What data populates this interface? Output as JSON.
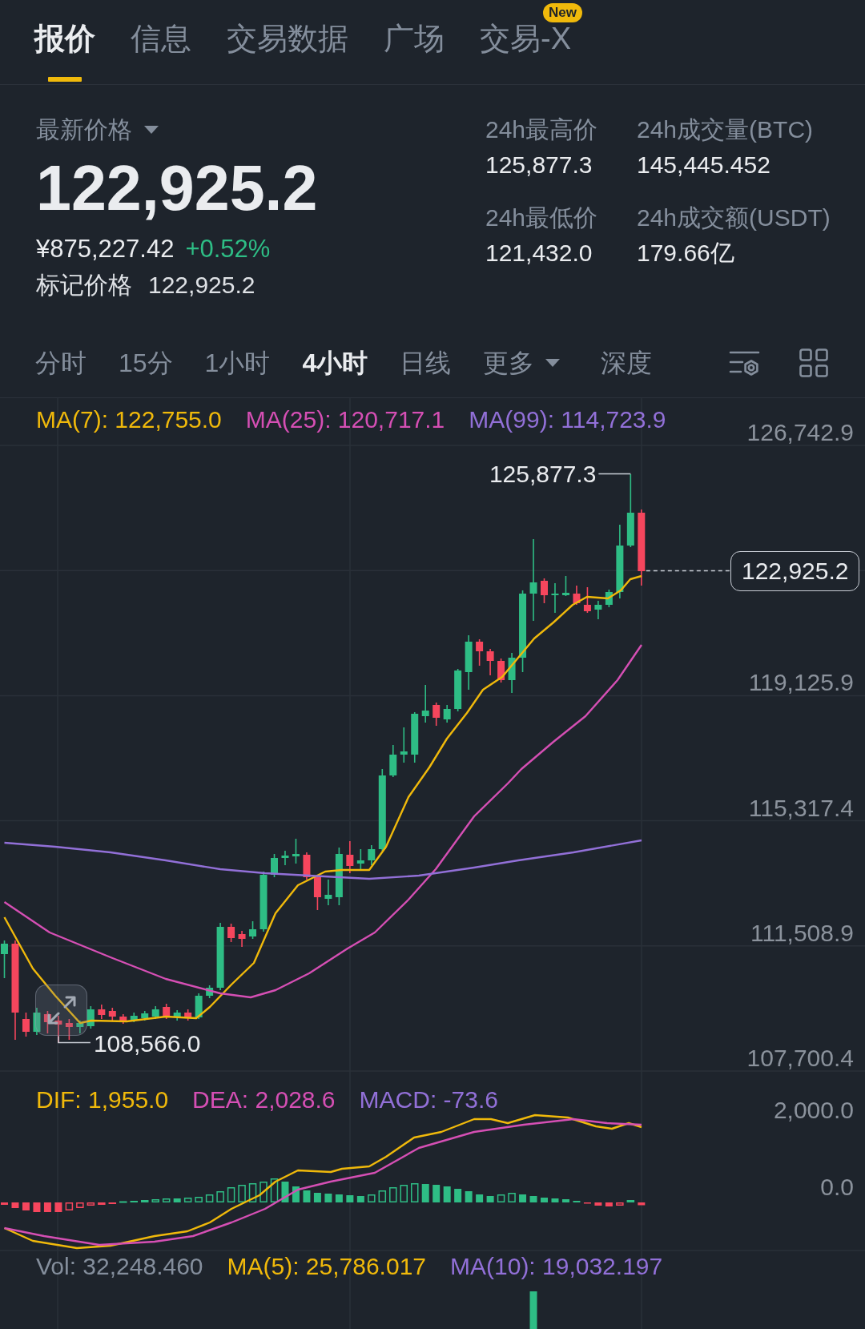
{
  "tabs": [
    {
      "label": "报价",
      "selected": true
    },
    {
      "label": "信息",
      "selected": false
    },
    {
      "label": "交易数据",
      "selected": false
    },
    {
      "label": "广场",
      "selected": false
    },
    {
      "label": "交易-X",
      "selected": false,
      "badge": "New"
    }
  ],
  "price": {
    "label": "最新价格",
    "last_price": "122,925.2",
    "fiat_price": "¥875,227.42",
    "change": "+0.52%",
    "change_up": true,
    "mark_price_label": "标记价格",
    "mark_price": "122,925.2"
  },
  "stats": [
    {
      "label": "24h最高价",
      "value": "125,877.3"
    },
    {
      "label": "24h成交量(BTC)",
      "value": "145,445.452"
    },
    {
      "label": "24h最低价",
      "value": "121,432.0"
    },
    {
      "label": "24h成交额(USDT)",
      "value": "179.66亿"
    }
  ],
  "intervals": [
    {
      "label": "分时",
      "kind": "interval",
      "selected": false
    },
    {
      "label": "15分",
      "kind": "interval",
      "selected": false
    },
    {
      "label": "1小时",
      "kind": "interval",
      "selected": false
    },
    {
      "label": "4小时",
      "kind": "interval",
      "selected": true
    },
    {
      "label": "日线",
      "kind": "interval",
      "selected": false
    },
    {
      "label": "更多",
      "kind": "menu",
      "selected": false
    },
    {
      "label": "深度",
      "kind": "interval",
      "selected": false
    }
  ],
  "chart": {
    "legend": [
      {
        "text": "MA(7): 122,755.0",
        "color": "#f0b90b"
      },
      {
        "text": "MA(25): 120,717.1",
        "color": "#d54fb4"
      },
      {
        "text": "MA(99): 114,723.9",
        "color": "#9270d8"
      }
    ],
    "price_axis": [
      "126,742.9",
      "119,125.9",
      "115,317.4",
      "111,508.9",
      "107,700.4"
    ],
    "high_label": "125,877.3",
    "low_label": "108,566.0",
    "current_price": "122,925.2"
  },
  "macd": {
    "legend": [
      {
        "text": "DIF: 1,955.0",
        "color": "#f0b90b"
      },
      {
        "text": "DEA: 2,028.6",
        "color": "#d54fb4"
      },
      {
        "text": "MACD: -73.6",
        "color": "#9270d8"
      }
    ],
    "axis": [
      "2,000.0",
      "0.0"
    ]
  },
  "volume": {
    "legend": [
      {
        "text": "Vol: 32,248.460",
        "color": "#848e9c"
      },
      {
        "text": "MA(5): 25,786.017",
        "color": "#f0b90b"
      },
      {
        "text": "MA(10): 19,032.197",
        "color": "#9270d8"
      }
    ]
  }
}
